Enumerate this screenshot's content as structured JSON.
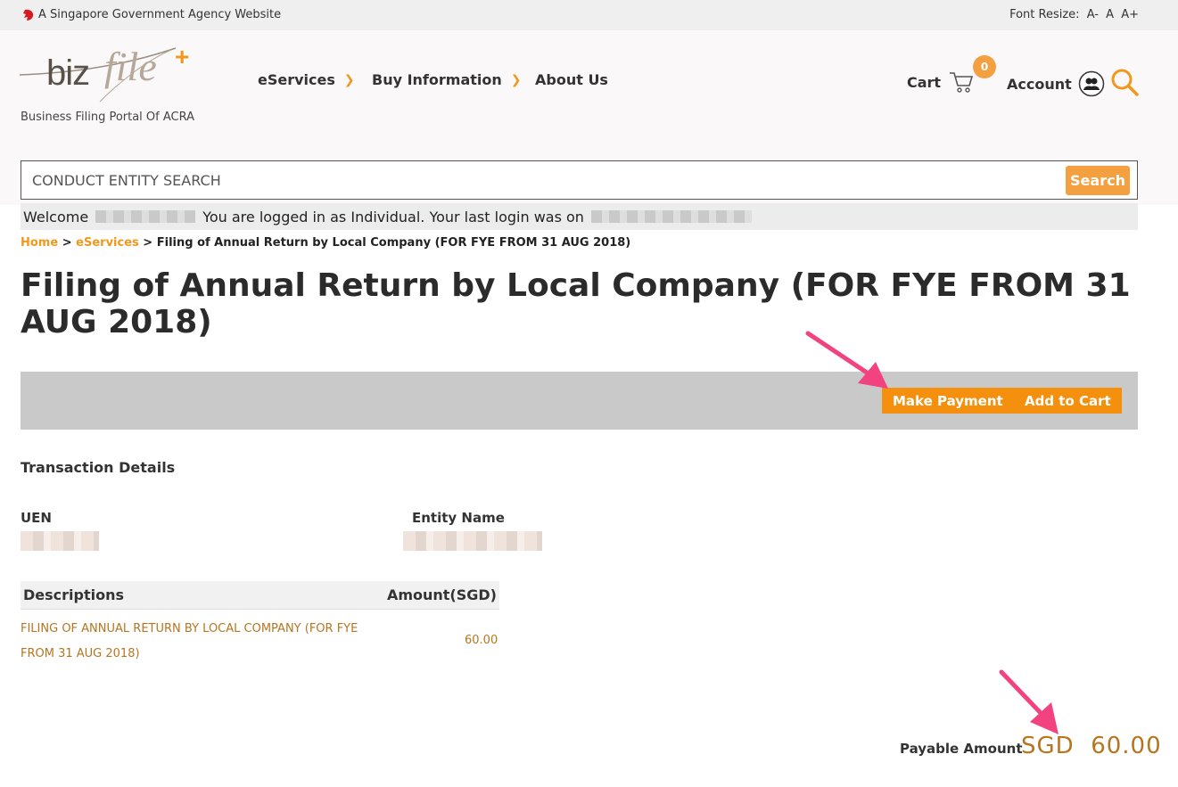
{
  "gov_bar": {
    "agency_text": "A Singapore Government Agency Website",
    "font_resize_label": "Font Resize:",
    "font_sizes": [
      "A-",
      "A",
      "A+"
    ]
  },
  "header": {
    "logo_text": "bizfile+",
    "tagline": "Business Filing Portal Of ACRA",
    "nav": [
      {
        "label": "eServices",
        "has_dropdown": true
      },
      {
        "label": "Buy Information",
        "has_dropdown": true
      },
      {
        "label": "About Us",
        "has_dropdown": false
      }
    ],
    "cart_label": "Cart",
    "cart_count": "0",
    "account_label": "Account",
    "accent_color": "#f0981c"
  },
  "search": {
    "placeholder": "CONDUCT ENTITY SEARCH",
    "button_label": "Search"
  },
  "welcome": {
    "prefix": "Welcome",
    "middle": "You are logged in as Individual. Your last login was on"
  },
  "breadcrumb": {
    "home": "Home",
    "eservices": "eServices",
    "current": "Filing of Annual Return by Local Company (FOR FYE FROM 31 AUG 2018)",
    "separator": ">"
  },
  "page_title": "Filing of Annual Return by Local Company (FOR FYE FROM 31 AUG 2018)",
  "actions": {
    "make_payment": "Make Payment",
    "add_to_cart": "Add to Cart"
  },
  "transaction": {
    "section_title": "Transaction Details",
    "uen_label": "UEN",
    "entity_name_label": "Entity Name",
    "table_headers": [
      "Descriptions",
      "Amount(SGD)"
    ],
    "rows": [
      {
        "description": "FILING OF ANNUAL RETURN BY LOCAL COMPANY (FOR FYE FROM 31 AUG 2018)",
        "amount": "60.00"
      }
    ],
    "payable_label": "Payable Amount",
    "payable_value": "SGD  60.00"
  },
  "annotation_color": "#f2427f"
}
